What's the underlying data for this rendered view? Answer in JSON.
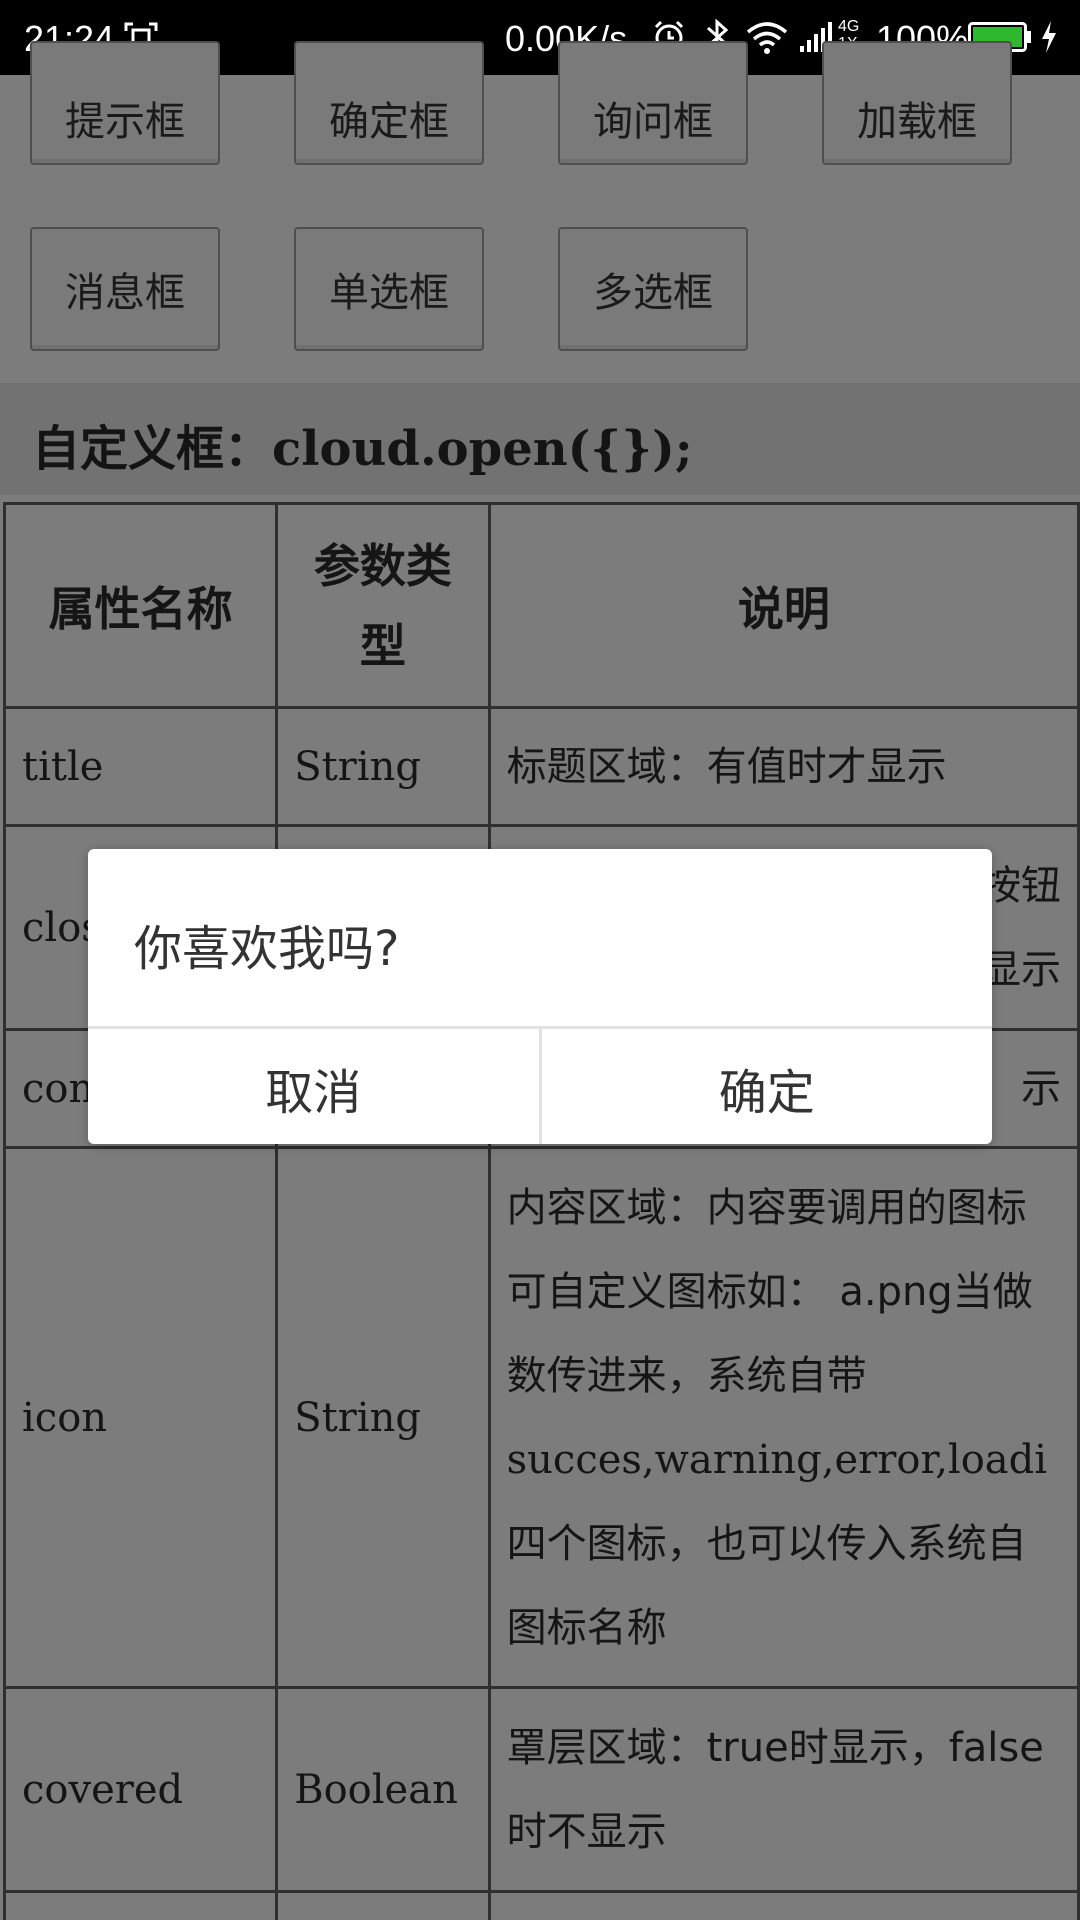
{
  "status_bar": {
    "time": "21:24",
    "net_speed": "0.00K/s",
    "network_type_top": "4G",
    "network_type_bottom": "1X",
    "battery_percent": "100%",
    "battery_level": 1.0,
    "battery_color": "#2eb82e"
  },
  "buttons": {
    "row1": [
      "提示框",
      "确定框",
      "询问框",
      "加载框"
    ],
    "row2": [
      "消息框",
      "单选框",
      "多选框"
    ]
  },
  "section_title": "自定义框：cloud.open({});",
  "table": {
    "headers": [
      "属性名称",
      "参数类型",
      "说明"
    ],
    "header_type_lines": [
      "参数类",
      "型"
    ],
    "rows": [
      {
        "name": "title",
        "type": "String",
        "desc": [
          "标题区域：有值时才显示"
        ]
      },
      {
        "name": "clos",
        "type": "",
        "desc": [
          "",
          "显示"
        ],
        "desc_partial": [
          "j按钮"
        ]
      },
      {
        "name": "con",
        "type": "",
        "desc": [
          "示"
        ]
      },
      {
        "name": "icon",
        "type": "String",
        "desc": [
          "内容区域：内容要调用的图标",
          "可自定义图标如： a.png当做",
          "数传进来，系统自带",
          "succes,warning,error,loadi",
          "四个图标，也可以传入系统自",
          "图标名称"
        ]
      },
      {
        "name": "covered",
        "type": "Boolean",
        "desc": [
          "罩层区域：true时显示，false",
          "时不显示"
        ]
      }
    ]
  },
  "dialog": {
    "message": "你喜欢我吗?",
    "cancel_label": "取消",
    "confirm_label": "确定"
  }
}
